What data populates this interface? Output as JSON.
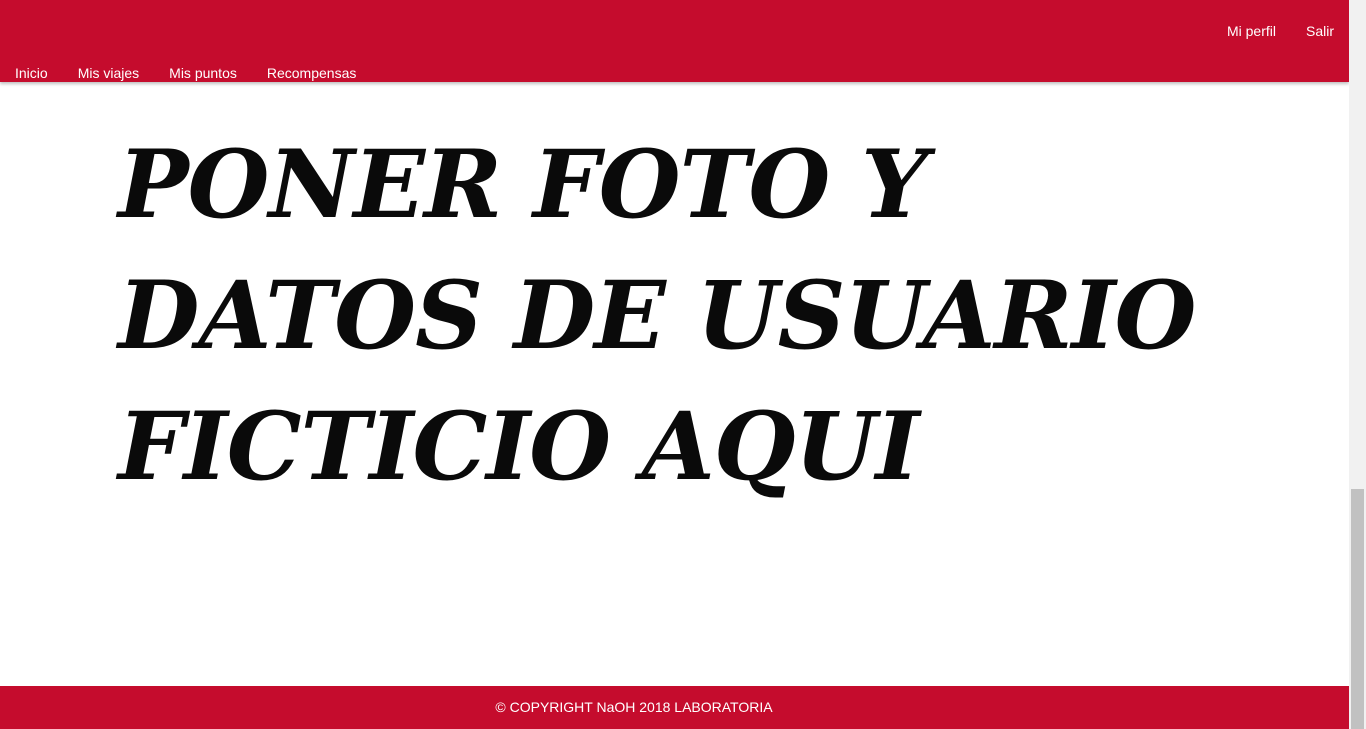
{
  "navbar": {
    "right_links": [
      {
        "label": "Mi perfil"
      },
      {
        "label": "Salir"
      }
    ],
    "left_links": [
      {
        "label": "Inicio"
      },
      {
        "label": "Mis viajes"
      },
      {
        "label": "Mis puntos"
      },
      {
        "label": "Recompensas"
      }
    ]
  },
  "main": {
    "placeholder_text": "PONER FOTO Y DATOS DE USUARIO FICTICIO AQUI"
  },
  "footer": {
    "copyright": "© COPYRIGHT NaOH 2018 LABORATORIA"
  },
  "colors": {
    "brand": "#c50c2d",
    "text_dark": "#0a0a0a",
    "nav_text": "#ffffff"
  }
}
